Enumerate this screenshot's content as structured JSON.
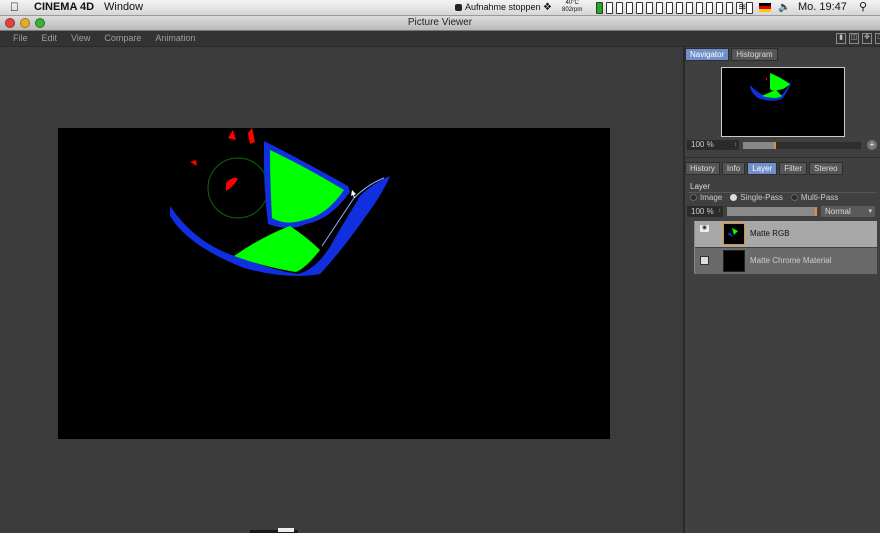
{
  "menubar": {
    "app_name": "CINEMA 4D",
    "window_menu": "Window",
    "recording_label": "Aufnahme stoppen",
    "temp_value": "40°C",
    "rpm_value": "802rpm",
    "clock": "Mo. 19:47"
  },
  "window": {
    "title": "Picture Viewer",
    "menu": [
      "File",
      "Edit",
      "View",
      "Compare",
      "Animation"
    ]
  },
  "navigator": {
    "tabs": [
      "Navigator",
      "Histogram"
    ],
    "active_tab": "Navigator",
    "zoom": "100 %",
    "zoom_fraction": 0.27
  },
  "panel_tabs": [
    "History",
    "Info",
    "Layer",
    "Filter",
    "Stereo"
  ],
  "active_panel_tab": "Layer",
  "layer": {
    "title": "Layer",
    "modes": [
      "Image",
      "Single-Pass",
      "Multi-Pass"
    ],
    "active_mode": "Single-Pass",
    "opacity": "100 %",
    "opacity_fraction": 1.0,
    "blend_mode": "Normal",
    "layers": [
      {
        "name": "Matte RGB",
        "selected": true
      },
      {
        "name": "Matte Chrome Material",
        "selected": false
      }
    ]
  },
  "colors": {
    "matte_green": "#00ff00",
    "matte_blue": "#1030e0",
    "matte_red": "#ff0000",
    "selection_accent": "#e09030",
    "active_tab": "#6f8fc9"
  }
}
